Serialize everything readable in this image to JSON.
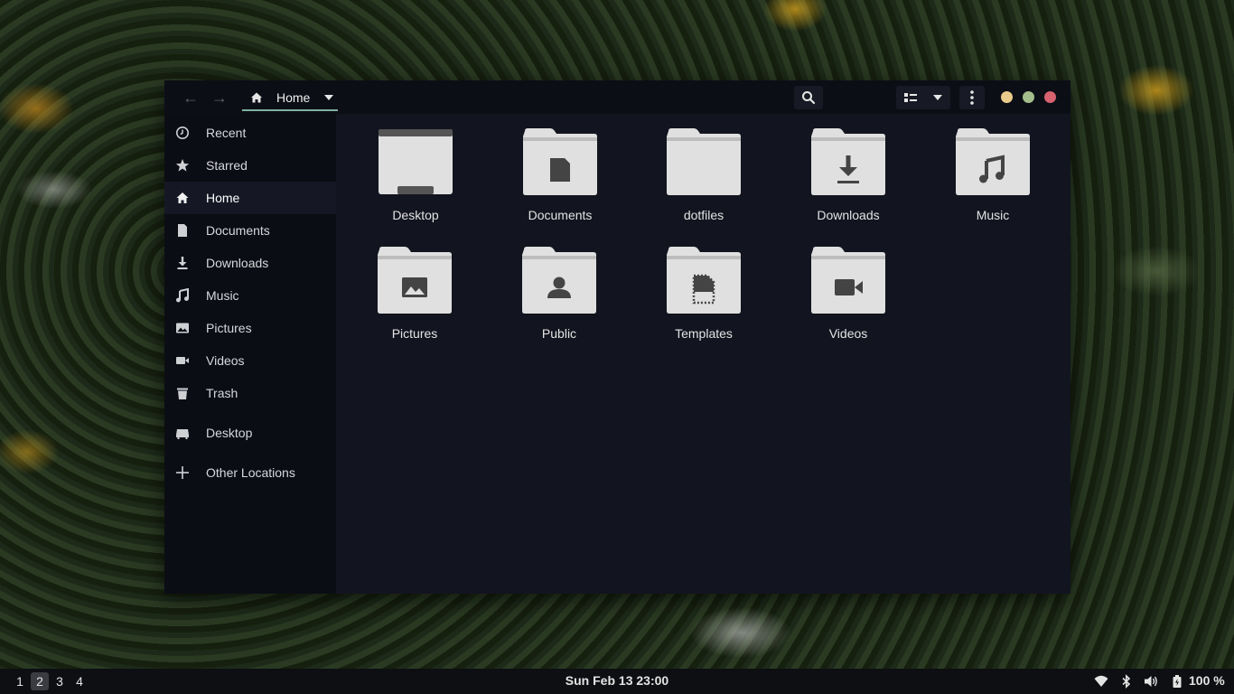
{
  "window": {
    "path": {
      "label": "Home"
    },
    "sidebar": {
      "items": [
        {
          "label": "Recent",
          "icon": "clock-icon"
        },
        {
          "label": "Starred",
          "icon": "star-icon"
        },
        {
          "label": "Home",
          "icon": "home-icon",
          "active": true
        },
        {
          "label": "Documents",
          "icon": "document-icon"
        },
        {
          "label": "Downloads",
          "icon": "download-icon"
        },
        {
          "label": "Music",
          "icon": "music-icon"
        },
        {
          "label": "Pictures",
          "icon": "image-icon"
        },
        {
          "label": "Videos",
          "icon": "video-icon"
        },
        {
          "label": "Trash",
          "icon": "trash-icon"
        },
        {
          "label": "Desktop",
          "icon": "drive-icon"
        },
        {
          "label": "Other Locations",
          "icon": "plus-icon"
        }
      ]
    },
    "files": [
      {
        "label": "Desktop",
        "icon": "desktop-folder-icon"
      },
      {
        "label": "Documents",
        "icon": "documents-folder-icon"
      },
      {
        "label": "dotfiles",
        "icon": "folder-icon"
      },
      {
        "label": "Downloads",
        "icon": "downloads-folder-icon"
      },
      {
        "label": "Music",
        "icon": "music-folder-icon"
      },
      {
        "label": "Pictures",
        "icon": "pictures-folder-icon"
      },
      {
        "label": "Public",
        "icon": "public-folder-icon"
      },
      {
        "label": "Templates",
        "icon": "templates-folder-icon"
      },
      {
        "label": "Videos",
        "icon": "videos-folder-icon"
      }
    ],
    "window_controls": {
      "minimize_color": "#ebcb8b",
      "maximize_color": "#a3be8c",
      "close_color": "#d6636f"
    }
  },
  "taskbar": {
    "workspaces": [
      "1",
      "2",
      "3",
      "4"
    ],
    "active_workspace": "2",
    "clock": "Sun Feb 13  23:00",
    "battery": "100 %",
    "tray_icons": [
      "wifi-icon",
      "bluetooth-icon",
      "volume-icon",
      "battery-icon"
    ]
  },
  "colors": {
    "accent": "#7fb0a0",
    "window_bg": "#12141f",
    "sidebar_bg": "#0b0d14",
    "folder": "#e0e0e0"
  }
}
